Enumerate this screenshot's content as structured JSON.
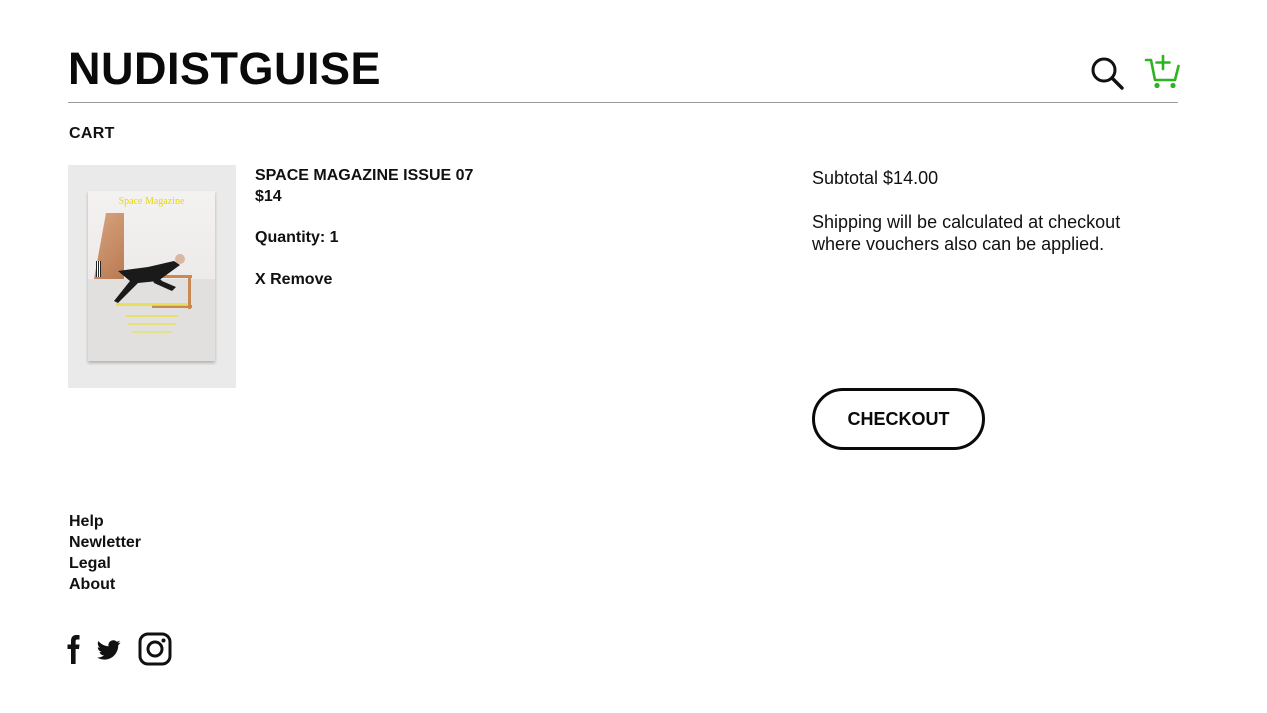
{
  "header": {
    "logo_text": "NUDISTGUISE",
    "search_icon": "search-icon",
    "cart_icon": "cart-add-icon",
    "cart_icon_color": "#2bb51f"
  },
  "cart": {
    "section_title": "CART",
    "item": {
      "name": "SPACE MAGAZINE ISSUE 07",
      "price": "$14",
      "quantity_text": "Quantity: 1",
      "remove_label": "X Remove",
      "image": {
        "cover_title": "Space Magazine"
      }
    },
    "summary": {
      "subtotal_text": "Subtotal $14.00",
      "shipping_note": "Shipping will be calculated at checkout where vouchers also can be applied.",
      "checkout_label": "CHECKOUT"
    }
  },
  "footer": {
    "links": [
      "Help",
      "Newletter",
      "Legal",
      "About"
    ],
    "social_icons": [
      "facebook-icon",
      "twitter-icon",
      "instagram-icon"
    ]
  },
  "colors": {
    "accent": "#2bb51f",
    "text": "#111111",
    "divider": "#9a9a9a",
    "thumb_bg": "#ebeaea"
  }
}
